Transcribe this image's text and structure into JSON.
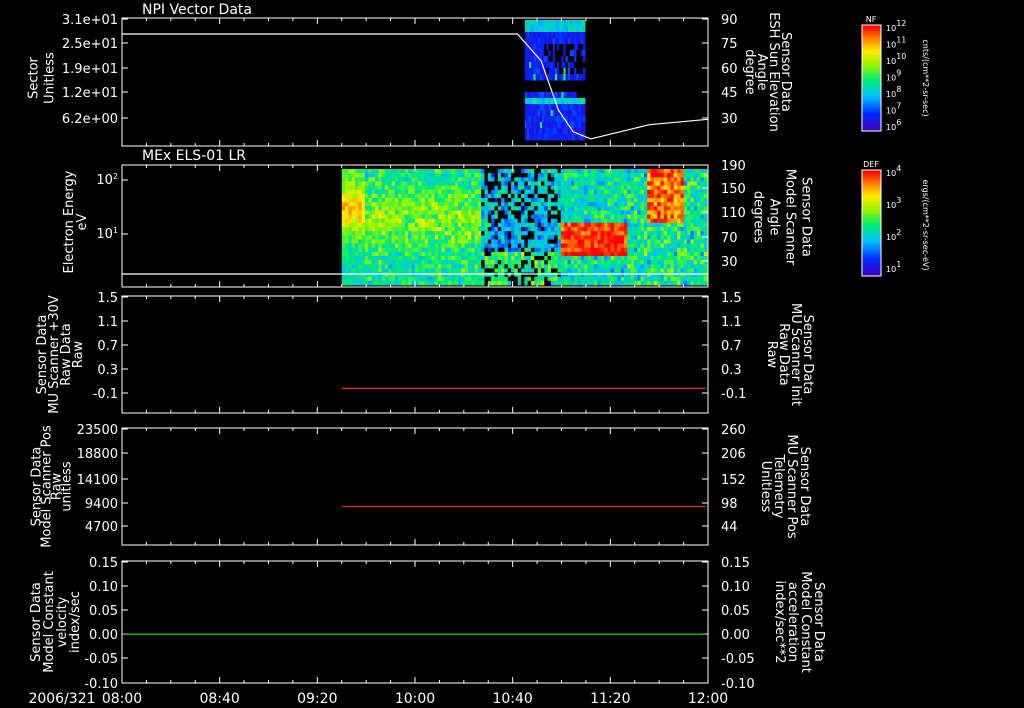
{
  "chart_data": [
    {
      "type": "heatmap",
      "title": "NPI Vector Data",
      "ylabel": [
        "Sector",
        "Unitless"
      ],
      "yticks": [
        "3.1e+01",
        "2.5e+01",
        "1.9e+01",
        "1.2e+01",
        "6.2e+00"
      ],
      "y2label": [
        "Sensor Data",
        "ESH Sun Elevation",
        "Angle",
        "degree"
      ],
      "y2ticks": [
        "90",
        "75",
        "60",
        "45",
        "30"
      ],
      "y2lim": [
        18,
        90
      ],
      "colorbar": {
        "label": "NF",
        "units": "cnts/(cm**2-sr-sec)",
        "ticks": [
          "10^12",
          "10^11",
          "10^10",
          "10^9",
          "10^8",
          "10^7",
          "10^6"
        ]
      },
      "series": [
        {
          "values": [
            [
              0,
              81
            ],
            [
              2.7,
              81
            ],
            [
              2.86,
              66
            ],
            [
              2.98,
              38
            ],
            [
              3.08,
              26
            ],
            [
              3.2,
              22
            ],
            [
              3.3,
              24
            ],
            [
              3.6,
              30
            ],
            [
              4.0,
              33
            ]
          ]
        }
      ],
      "data_span": [
        2.75,
        3.16
      ]
    },
    {
      "type": "heatmap",
      "title": "MEx ELS-01 LR",
      "ylabel": [
        "Electron Energy",
        "eV"
      ],
      "yticks": [
        "10^2",
        "10^1"
      ],
      "y2label": [
        "Sensor Data",
        "Model Scanner",
        "Angle",
        "degrees"
      ],
      "y2ticks": [
        "190",
        "150",
        "110",
        "70",
        "30"
      ],
      "colorbar": {
        "label": "DEF",
        "units": "ergs/(cm**2-sr-sec-eV)",
        "ticks": [
          "10^4",
          "10^3",
          "10^2",
          "10^1"
        ]
      },
      "data_span": [
        1.5,
        4.0
      ]
    },
    {
      "type": "line",
      "ylabel": [
        "Sensor Data",
        "MU Scanner +30V",
        "Raw Data",
        "Raw"
      ],
      "yticks": [
        "1.5",
        "1.1",
        "0.7",
        "0.3",
        "-0.1"
      ],
      "y2label": [
        "Sensor Data",
        "MU Scanner Init",
        "Raw Data",
        "Raw"
      ],
      "y2ticks": [
        "1.5",
        "1.1",
        "0.7",
        "0.3",
        "-0.1"
      ],
      "ylim": [
        -0.4,
        1.5
      ],
      "series": [
        {
          "color": "#ff2020",
          "x": [
            1.5,
            4.0
          ],
          "y": [
            0,
            0
          ]
        }
      ]
    },
    {
      "type": "line",
      "ylabel": [
        "Sensor Data",
        "Model Scanner Pos",
        "Raw",
        "unitless"
      ],
      "yticks": [
        "23500",
        "18800",
        "14100",
        "9400",
        "4700"
      ],
      "y2label": [
        "Sensor Data",
        "MU Scanner Pos",
        "Telemetry",
        "Unitless"
      ],
      "y2ticks": [
        "260",
        "206",
        "152",
        "98",
        "44"
      ],
      "ylim": [
        0,
        23500
      ],
      "series": [
        {
          "color": "#ff2020",
          "x": [
            1.5,
            4.0
          ],
          "y": [
            7750,
            7750
          ]
        }
      ]
    },
    {
      "type": "line",
      "ylabel": [
        "Sensor Data",
        "Model Constant",
        "velocity",
        "index/sec"
      ],
      "yticks": [
        "0.15",
        "0.10",
        "0.05",
        "0.00",
        "-0.05",
        "-0.10"
      ],
      "y2label": [
        "Sensor Data",
        "Model Constant",
        "acceleration",
        "index/sec**2"
      ],
      "y2ticks": [
        "0.15",
        "0.10",
        "0.05",
        "0.00",
        "-0.05",
        "-0.10"
      ],
      "ylim": [
        -0.1,
        0.15
      ],
      "series": [
        {
          "color": "#30e030",
          "x": [
            0,
            4.0
          ],
          "y": [
            0,
            0
          ]
        }
      ]
    }
  ],
  "time_axis": {
    "date": "2006/321",
    "ticks": [
      "08:00",
      "08:40",
      "09:20",
      "10:00",
      "10:40",
      "11:20",
      "12:00"
    ],
    "range_hours": [
      0,
      4
    ]
  },
  "colors": {
    "red": "#ff2020",
    "green": "#30e030",
    "white": "#ffffff"
  }
}
